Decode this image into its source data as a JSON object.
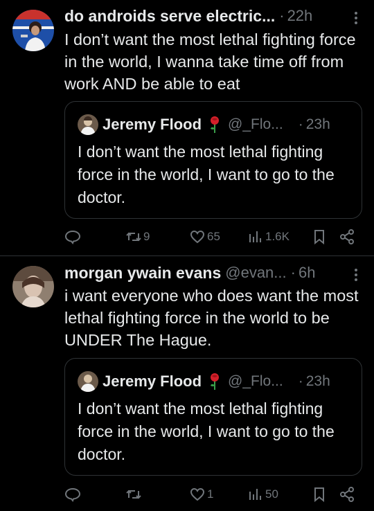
{
  "posts": [
    {
      "author_name": "do androids serve electric...",
      "handle": "",
      "separator": "·",
      "time": "22h",
      "text": "I don’t want the most lethal fighting force in the world, I wanna take time off from work AND be able to eat",
      "quote": {
        "author_name": "Jeremy Flood",
        "emoji": "rose",
        "handle": "@_Flo...",
        "separator": "·",
        "time": "23h",
        "text": "I don’t want the most lethal fighting force in the world, I want to go to the doctor."
      },
      "stats": {
        "replies": "",
        "reposts": "9",
        "likes": "65",
        "views": "1.6K"
      }
    },
    {
      "author_name": "morgan ywain evans",
      "handle": "@evan...",
      "separator": "·",
      "time": "6h",
      "text": "i want everyone who does want the most lethal fighting force in the world to be UNDER The Hague.",
      "quote": {
        "author_name": "Jeremy Flood",
        "emoji": "rose",
        "handle": "@_Flo...",
        "separator": "·",
        "time": "23h",
        "text": "I don’t want the most lethal fighting force in the world, I want to go to the doctor."
      },
      "stats": {
        "replies": "",
        "reposts": "",
        "likes": "1",
        "views": "50"
      }
    }
  ],
  "icons": {
    "reply": "reply-icon",
    "repost": "repost-icon",
    "like": "heart-icon",
    "views": "views-icon",
    "bookmark": "bookmark-icon",
    "share": "share-icon",
    "more": "more-dots-icon"
  },
  "colors": {
    "background": "#000000",
    "text": "#e7e9ea",
    "secondary": "#71767b",
    "border": "#2f3336"
  }
}
